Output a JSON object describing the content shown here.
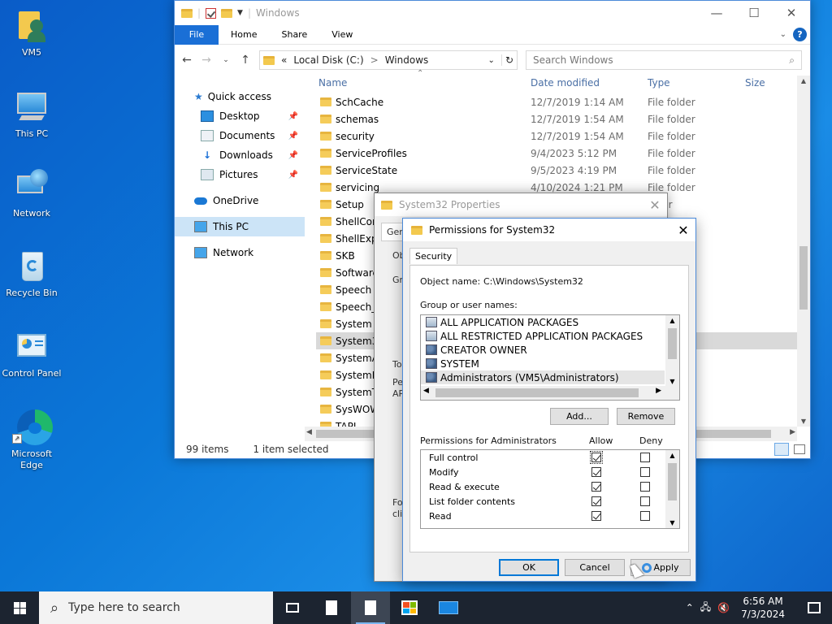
{
  "desktop": {
    "icons": [
      {
        "label": "VM5",
        "icon": "user-folder-icon"
      },
      {
        "label": "This PC",
        "icon": "computer-icon"
      },
      {
        "label": "Network",
        "icon": "network-icon"
      },
      {
        "label": "Recycle Bin",
        "icon": "recycle-bin-icon"
      },
      {
        "label": "Control Panel",
        "icon": "control-panel-icon"
      },
      {
        "label": "Microsoft Edge",
        "icon": "edge-icon"
      }
    ]
  },
  "explorer": {
    "title": "Windows",
    "ribbon_tabs": [
      "File",
      "Home",
      "Share",
      "View"
    ],
    "address": {
      "prefix": "«",
      "parts": [
        "Local Disk (C:)",
        "Windows"
      ],
      "sep": ">"
    },
    "search_placeholder": "Search Windows",
    "nav": {
      "quick_access": "Quick access",
      "quick_items": [
        "Desktop",
        "Documents",
        "Downloads",
        "Pictures"
      ],
      "onedrive": "OneDrive",
      "this_pc": "This PC",
      "network": "Network"
    },
    "columns": {
      "name": "Name",
      "date": "Date modified",
      "type": "Type",
      "size": "Size"
    },
    "files": [
      {
        "name": "SchCache",
        "date": "12/7/2019 1:14 AM",
        "type": "File folder"
      },
      {
        "name": "schemas",
        "date": "12/7/2019 1:54 AM",
        "type": "File folder"
      },
      {
        "name": "security",
        "date": "12/7/2019 1:54 AM",
        "type": "File folder"
      },
      {
        "name": "ServiceProfiles",
        "date": "9/4/2023 5:12 PM",
        "type": "File folder"
      },
      {
        "name": "ServiceState",
        "date": "9/5/2023 4:19 PM",
        "type": "File folder"
      },
      {
        "name": "servicing",
        "date": "4/10/2024 1:21 PM",
        "type": "File folder"
      },
      {
        "name": "Setup",
        "date": "",
        "type": "older"
      },
      {
        "name": "ShellCom",
        "date": "",
        "type": ""
      },
      {
        "name": "ShellExpe",
        "date": "",
        "type": ""
      },
      {
        "name": "SKB",
        "date": "",
        "type": ""
      },
      {
        "name": "SoftwareI",
        "date": "",
        "type": ""
      },
      {
        "name": "Speech",
        "date": "",
        "type": ""
      },
      {
        "name": "Speech_C",
        "date": "",
        "type": ""
      },
      {
        "name": "System",
        "date": "",
        "type": ""
      },
      {
        "name": "System32",
        "date": "",
        "type": ""
      },
      {
        "name": "SystemAp",
        "date": "",
        "type": ""
      },
      {
        "name": "SystemRe",
        "date": "",
        "type": ""
      },
      {
        "name": "SystemTe",
        "date": "",
        "type": ""
      },
      {
        "name": "SysWOW",
        "date": "",
        "type": ""
      },
      {
        "name": "TAPI",
        "date": "",
        "type": ""
      }
    ],
    "selected_index": 14,
    "status": {
      "items": "99 items",
      "selected": "1 item selected"
    }
  },
  "props_dialog": {
    "title": "System32 Properties",
    "tab_fragment": "Gen",
    "fragments": [
      "Ob",
      "Gr",
      "To",
      "Pe",
      "AP",
      "Fo",
      "clic"
    ]
  },
  "perm_dialog": {
    "title": "Permissions for System32",
    "tab": "Security",
    "object_label": "Object name:",
    "object_value": "C:\\Windows\\System32",
    "group_label": "Group or user names:",
    "users": [
      {
        "name": "ALL APPLICATION PACKAGES",
        "icon": "package-group-icon"
      },
      {
        "name": "ALL RESTRICTED APPLICATION PACKAGES",
        "icon": "package-group-icon"
      },
      {
        "name": "CREATOR OWNER",
        "icon": "user-group-icon"
      },
      {
        "name": "SYSTEM",
        "icon": "user-group-icon"
      },
      {
        "name": "Administrators (VM5\\Administrators)",
        "icon": "user-group-icon"
      }
    ],
    "selected_user_index": 4,
    "add_label": "Add...",
    "remove_label": "Remove",
    "perm_header": "Permissions for Administrators",
    "allow_label": "Allow",
    "deny_label": "Deny",
    "permissions": [
      {
        "name": "Full control",
        "allow": true,
        "deny": false
      },
      {
        "name": "Modify",
        "allow": true,
        "deny": false
      },
      {
        "name": "Read & execute",
        "allow": true,
        "deny": false
      },
      {
        "name": "List folder contents",
        "allow": true,
        "deny": false
      },
      {
        "name": "Read",
        "allow": true,
        "deny": false
      }
    ],
    "ok_label": "OK",
    "cancel_label": "Cancel",
    "apply_label": "Apply"
  },
  "taskbar": {
    "search_placeholder": "Type here to search",
    "time": "6:56 AM",
    "date": "7/3/2024"
  }
}
